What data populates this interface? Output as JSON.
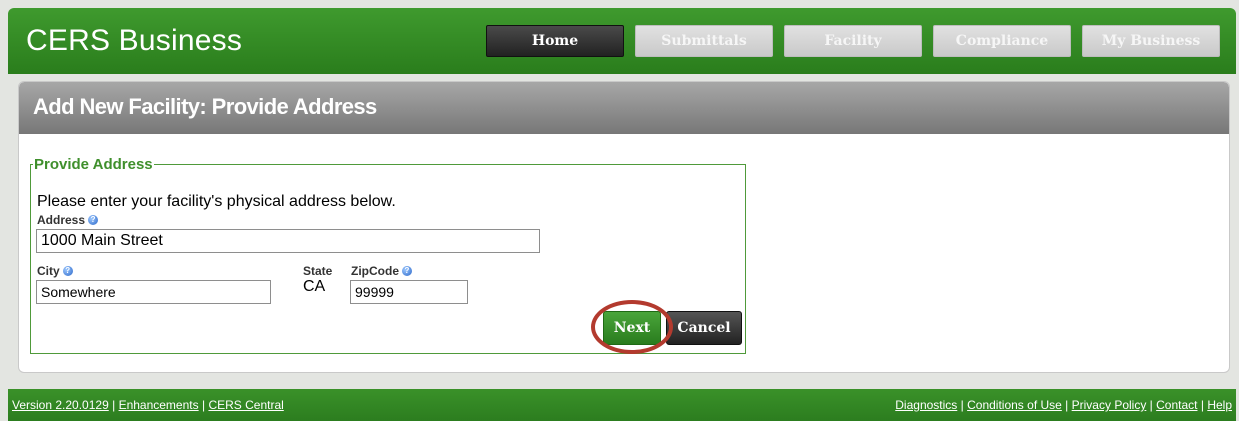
{
  "header": {
    "brand": "CERS Business",
    "nav": [
      {
        "label": "Home",
        "active": true
      },
      {
        "label": "Submittals",
        "active": false
      },
      {
        "label": "Facility",
        "active": false
      },
      {
        "label": "Compliance",
        "active": false
      },
      {
        "label": "My Business",
        "active": false
      }
    ]
  },
  "page": {
    "title": "Add New Facility: Provide Address",
    "section_legend": "Provide Address",
    "instructions": "Please enter your facility's physical address below."
  },
  "form": {
    "address_label": "Address",
    "address_value": "1000 Main Street",
    "city_label": "City",
    "city_value": "Somewhere",
    "state_label": "State",
    "state_value": "CA",
    "zip_label": "ZipCode",
    "zip_value": "99999",
    "help_icon": "?",
    "next_label": "Next",
    "cancel_label": "Cancel"
  },
  "footer": {
    "version": "Version 2.20.0129",
    "enhancements": "Enhancements",
    "cers_central": "CERS Central",
    "diagnostics": "Diagnostics",
    "conditions": "Conditions of Use",
    "privacy": "Privacy Policy",
    "contact": "Contact",
    "help": "Help",
    "separator": "|"
  },
  "colors": {
    "brand_green": "#2e8a21",
    "nav_active": "#2b2b2b",
    "nav_inactive": "#d3d3d3",
    "panel_header": "#8a8a8a",
    "highlight_ring": "#b33a2e"
  }
}
